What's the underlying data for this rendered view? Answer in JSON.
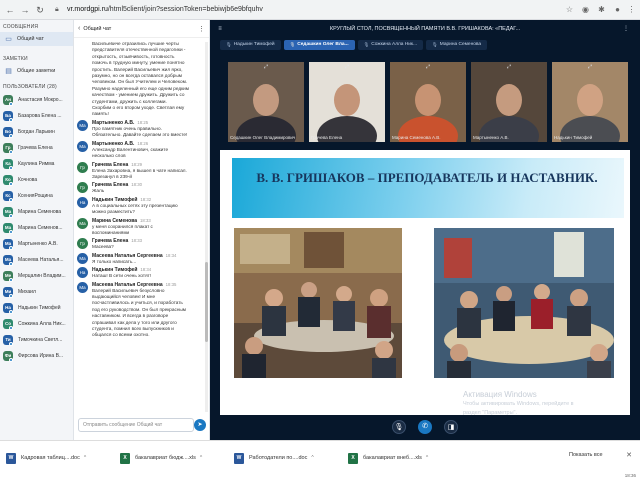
{
  "browser": {
    "url_host": "vr.mordgpi.ru",
    "url_path": "/html5client/join?sessionToken=bebiwjb6e9bfquhv"
  },
  "sidebar": {
    "messages_header": "СООБЩЕНИЯ",
    "public_chat": "Общий чат",
    "notes_header": "ЗАМЕТКИ",
    "shared_notes": "Общие заметки",
    "users_header": "ПОЛЬЗОВАТЕЛИ (28)",
    "users": [
      {
        "initials": "Ан",
        "name": "Анастасия Мокро...",
        "color": "#3d7e5a"
      },
      {
        "initials": "Ба",
        "name": "Базарова Елена ...",
        "color": "#2660a6"
      },
      {
        "initials": "Бо",
        "name": "Богдан Ларькин",
        "color": "#2660a6"
      },
      {
        "initials": "Гр",
        "name": "Грачева Елена",
        "color": "#3d7e5a"
      },
      {
        "initials": "Ка",
        "name": "Каулина Римма",
        "color": "#2f8a6e"
      },
      {
        "initials": "Ко",
        "name": "Кочнова",
        "color": "#2f8a6e"
      },
      {
        "initials": "Кс",
        "name": "КсенияРощина",
        "color": "#2660a6"
      },
      {
        "initials": "Ма",
        "name": "Марина Семенова",
        "color": "#2f8a6e"
      },
      {
        "initials": "Ма",
        "name": "Марина Семенов...",
        "color": "#2f8a6e"
      },
      {
        "initials": "Ма",
        "name": "Мартыненко А.В.",
        "color": "#2660a6"
      },
      {
        "initials": "Ма",
        "name": "Масеева Наталья...",
        "color": "#2660a6"
      },
      {
        "initials": "Ме",
        "name": "Мерцалин Владим...",
        "color": "#3d7e5a"
      },
      {
        "initials": "Ми",
        "name": "Михаил",
        "color": "#2660a6"
      },
      {
        "initials": "На",
        "name": "Надькин Тимофей",
        "color": "#2660a6"
      },
      {
        "initials": "Со",
        "name": "Сожкина Алла Ник...",
        "color": "#2f8a6e"
      },
      {
        "initials": "Ти",
        "name": "Тимочкина Светл...",
        "color": "#2660a6"
      },
      {
        "initials": "Фи",
        "name": "Фирсова Ирина В...",
        "color": "#3d7e5a"
      }
    ]
  },
  "chat": {
    "title": "Общий чат",
    "intro_lines": [
      "Васильевиче отразились лучшие черты",
      "представителя отечественной педагогики -",
      "открытость, отзывчивость, готовность",
      "помочь в трудную минуту, умение понятно",
      "простить. Валерий Васильевич жил ярко,",
      "разумно, но он всегда оставался добрым",
      "человеком. Он был Учителем и Человеком.",
      "Разумно наделенный его еще одним редким",
      "качеством - умением дружить. Дружить со",
      "студентами, дружить с коллегами.",
      "Скорбим о его втором уходе. Светлая ему",
      "память!"
    ],
    "messages": [
      {
        "av": "Ма",
        "avc": "",
        "name": "Мартыненко А.В.",
        "time": "18:25",
        "lines": [
          "Про памятник очень правильно.",
          "Обязательно. Давайте сделаем это вместе!"
        ]
      },
      {
        "av": "Ма",
        "avc": "",
        "name": "Мартыненко А.В.",
        "time": "18:26",
        "lines": [
          "Александр Валентинович, скажите",
          "несколько слов"
        ]
      },
      {
        "av": "Гр",
        "avc": "green",
        "name": "Грачева Елена",
        "time": "18:29",
        "lines": [
          "Елена Захаровна, я вышел в чате написал.",
          "Зарезанул в 239-й"
        ]
      },
      {
        "av": "Гр",
        "avc": "green",
        "name": "Грачева Елена",
        "time": "18:30",
        "lines": [
          "Жаль"
        ]
      },
      {
        "av": "На",
        "avc": "",
        "name": "Надькин Тимофей",
        "time": "18:32",
        "lines": [
          "А в социальных сетях эту презентацию",
          "можно разместить?"
        ]
      },
      {
        "av": "Ма",
        "avc": "green",
        "name": "Марина Семенова",
        "time": "18:33",
        "lines": [
          "у меня сохранился плакат с",
          "воспоминаниями"
        ]
      },
      {
        "av": "Гр",
        "avc": "green",
        "name": "Грачева Елена",
        "time": "18:33",
        "lines": [
          "Масеева?"
        ]
      },
      {
        "av": "Ма",
        "avc": "",
        "name": "Масеева Наталья Сергеевна",
        "time": "18:34",
        "lines": [
          "Я только написать..."
        ]
      },
      {
        "av": "На",
        "avc": "",
        "name": "Надькин Тимофей",
        "time": "18:34",
        "lines": [
          "Наташ! В сети очень хотят!"
        ]
      },
      {
        "av": "Ма",
        "avc": "",
        "name": "Масеева Наталья Сергеевна",
        "time": "18:35",
        "lines": [
          "Валерий Васильевич безусловно",
          "выдающийся человек! И мне",
          "посчастливилось и учиться, и поработать",
          "под его руководством. Он был прекрасным",
          "наставником. И всегда в разговоре",
          "спрашивал как дела у того или другого",
          "студента, помнил всех выпускников и",
          "общался со всеми охотно."
        ]
      }
    ],
    "input_placeholder": "Отправить сообщение Общий чат"
  },
  "main": {
    "title": "КРУГЛЫЙ СТОЛ, ПОСВЯЩЕННЫЙ ПАМЯТИ В.В. ГРИШАКОВА: «ПЕДАГ...",
    "tags": [
      {
        "label": "Надькин Тимофей",
        "active": false
      },
      {
        "label": "Седашкин Олег Вла...",
        "active": true
      },
      {
        "label": "Сожкина Алла Ник...",
        "active": false
      },
      {
        "label": "Марина Семенова",
        "active": false
      }
    ],
    "videos": [
      {
        "caption": "Седашкин Олег Владимирович",
        "bg": "#6a5a4c",
        "face": "#c39a80",
        "shirt": "#2a2a33"
      },
      {
        "caption": "Грачева Елена",
        "bg": "#e4e0d8",
        "face": "#c49579",
        "shirt": "#35343a"
      },
      {
        "caption": "Марина Семенова А.В.",
        "bg": "#7a6148",
        "face": "#c79373",
        "shirt": "#c9522e"
      },
      {
        "caption": "Мартыненко А.В.",
        "bg": "#55473b",
        "face": "#c59b7f",
        "shirt": "#3b3e48"
      },
      {
        "caption": "Надькин Тимофей",
        "bg": "#a38768",
        "face": "#d0a283",
        "shirt": "#4b4d52"
      }
    ],
    "slide_title": "В. В. ГРИШАКОВ – ПРЕПОДАВАТЕЛЬ И НАСТАВНИК.",
    "windows_activation_title": "Активация Windows",
    "windows_activation_line1": "Чтобы активировать Windows, перейдите в",
    "windows_activation_line2": "раздел \"Параметры\"."
  },
  "taskbar": {
    "files": [
      {
        "name": "Кадровая таблиц....doc",
        "type": "W",
        "color": "#2b579a"
      },
      {
        "name": "бакалавриат бюдж....xls",
        "type": "X",
        "color": "#217346"
      },
      {
        "name": "Работодатели по....doc",
        "type": "W",
        "color": "#2b579a"
      },
      {
        "name": "бакалавриат внеб....xls",
        "type": "X",
        "color": "#217346"
      }
    ],
    "show_all": "Показать все",
    "clock": "18:36"
  }
}
